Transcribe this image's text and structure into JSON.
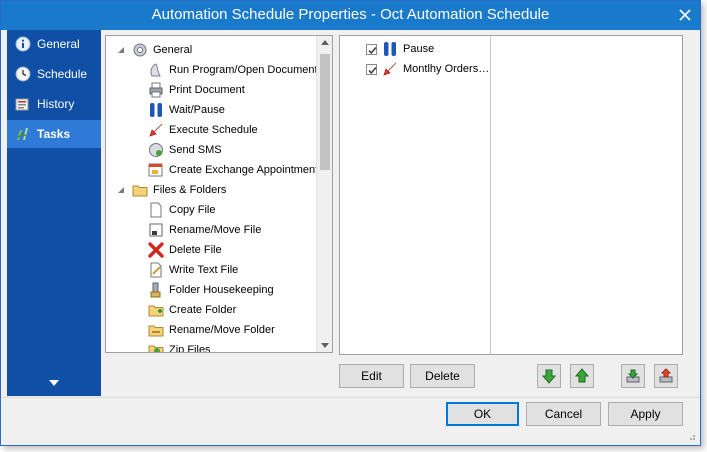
{
  "window": {
    "title": "Automation Schedule Properties - Oct  Automation Schedule"
  },
  "sidebar": {
    "items": [
      {
        "label": "General",
        "icon": "info-icon",
        "active": false
      },
      {
        "label": "Schedule",
        "icon": "clock-icon",
        "active": false
      },
      {
        "label": "History",
        "icon": "history-icon",
        "active": false
      },
      {
        "label": "Tasks",
        "icon": "tasks-icon",
        "active": true
      }
    ]
  },
  "tree": {
    "groups": [
      {
        "label": "General",
        "icon": "gear-icon",
        "items": [
          {
            "label": "Run Program/Open Document",
            "icon": "run-program-icon"
          },
          {
            "label": "Print Document",
            "icon": "printer-icon"
          },
          {
            "label": "Wait/Pause",
            "icon": "pause-icon"
          },
          {
            "label": "Execute Schedule",
            "icon": "execute-schedule-icon"
          },
          {
            "label": "Send SMS",
            "icon": "sms-icon"
          },
          {
            "label": "Create Exchange Appointment",
            "icon": "exchange-appointment-icon"
          }
        ]
      },
      {
        "label": "Files & Folders",
        "icon": "folder-icon",
        "items": [
          {
            "label": "Copy File",
            "icon": "copy-file-icon"
          },
          {
            "label": "Rename/Move File",
            "icon": "rename-file-icon"
          },
          {
            "label": "Delete File",
            "icon": "delete-icon"
          },
          {
            "label": "Write Text File",
            "icon": "write-text-icon"
          },
          {
            "label": "Folder Housekeeping",
            "icon": "housekeeping-icon"
          },
          {
            "label": "Create Folder",
            "icon": "create-folder-icon"
          },
          {
            "label": "Rename/Move Folder",
            "icon": "rename-folder-icon"
          },
          {
            "label": "Zip Files",
            "icon": "zip-icon"
          }
        ]
      }
    ]
  },
  "tasks": [
    {
      "label": "Pause",
      "checked": true,
      "icon": "pause-icon"
    },
    {
      "label": "Montlhy Orders…",
      "checked": true,
      "icon": "execute-schedule-icon"
    }
  ],
  "buttons": {
    "edit": "Edit",
    "delete": "Delete",
    "ok": "OK",
    "cancel": "Cancel",
    "apply": "Apply"
  },
  "colors": {
    "titlebar": "#1979ca",
    "sidebar": "#0f4fa6",
    "sidebar_active": "#2f7ad6"
  }
}
